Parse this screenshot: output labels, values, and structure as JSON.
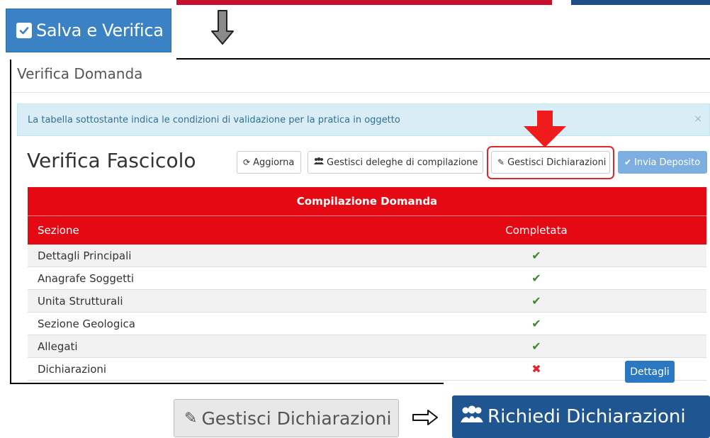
{
  "salva_button": {
    "label": "Salva e Verifica",
    "icon": "checkbox-icon"
  },
  "page_header": {
    "title": "Verifica Domanda"
  },
  "alert": {
    "text": "La tabella sottostante indica le condizioni di validazione per la pratica in oggetto",
    "close": "×"
  },
  "section_title": "Verifica Fascicolo",
  "toolbar": {
    "aggiorna": "Aggiorna",
    "deleghe": "Gestisci deleghe di compilazione",
    "dichiarazioni": "Gestisci Dichiarazioni",
    "invia": "Invia Deposito"
  },
  "table": {
    "title": "Compilazione Domanda",
    "headers": {
      "sezione": "Sezione",
      "completata": "Completata"
    },
    "rows": [
      {
        "sezione": "Dettagli Principali",
        "status": "✔"
      },
      {
        "sezione": "Anagrafe Soggetti",
        "status": "✔"
      },
      {
        "sezione": "Unita Strutturali",
        "status": "✔"
      },
      {
        "sezione": "Sezione Geologica",
        "status": "✔"
      },
      {
        "sezione": "Allegati",
        "status": "✔"
      },
      {
        "sezione": "Dichiarazioni",
        "status": "✖",
        "action": "Dettagli"
      }
    ]
  },
  "bottom": {
    "gestisci_label": "Gestisci Dichiarazioni",
    "richiedi_label": "Richiedi Dichiarazioni"
  },
  "colors": {
    "primary_blue": "#3a82c4",
    "dark_blue": "#1f5590",
    "table_red": "#e50914",
    "highlight_red": "#e0262b",
    "check_green": "#3c8a2e"
  }
}
